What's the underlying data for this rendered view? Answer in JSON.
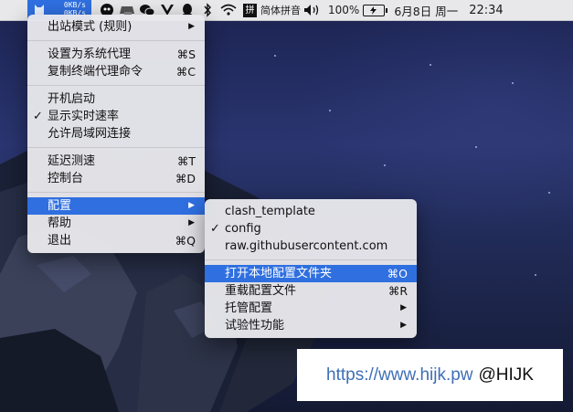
{
  "menubar": {
    "speed_up": "0KB/s",
    "speed_down": "0KB/s",
    "ime_glyph": "拼",
    "ime_label": "简体拼音",
    "battery_percent": "100%",
    "date": "6月8日 周一",
    "time": "22:34",
    "tray_icons": [
      "network-speed-icon",
      "notes-icon",
      "wechat-icon",
      "vue-icon",
      "qq-icon",
      "bluetooth-icon",
      "wifi-icon",
      "ime-icon",
      "volume-icon",
      "battery-icon"
    ]
  },
  "main_menu": {
    "items": [
      {
        "label": "出站模式 (规则)",
        "shortcut": "",
        "submenu": true
      },
      {
        "label": "设置为系统代理",
        "shortcut": "⌘S"
      },
      {
        "label": "复制终端代理命令",
        "shortcut": "⌘C"
      },
      {
        "label": "开机启动",
        "shortcut": ""
      },
      {
        "label": "显示实时速率",
        "shortcut": "",
        "checked": true
      },
      {
        "label": "允许局域网连接",
        "shortcut": ""
      },
      {
        "label": "延迟测速",
        "shortcut": "⌘T"
      },
      {
        "label": "控制台",
        "shortcut": "⌘D"
      },
      {
        "label": "配置",
        "shortcut": "",
        "submenu": true,
        "highlighted": true
      },
      {
        "label": "帮助",
        "shortcut": "",
        "submenu": true
      },
      {
        "label": "退出",
        "shortcut": "⌘Q"
      }
    ]
  },
  "config_submenu": {
    "items": [
      {
        "label": "clash_template"
      },
      {
        "label": "config",
        "checked": true
      },
      {
        "label": "raw.githubusercontent.com"
      },
      {
        "label": "打开本地配置文件夹",
        "shortcut": "⌘O",
        "highlighted": true
      },
      {
        "label": "重载配置文件",
        "shortcut": "⌘R"
      },
      {
        "label": "托管配置",
        "submenu": true
      },
      {
        "label": "试验性功能",
        "submenu": true
      }
    ]
  },
  "watermark": {
    "url": "https://www.hijk.pw",
    "handle": "@HIJK"
  },
  "symbols": {
    "check": "✓",
    "arrow": "▶"
  },
  "colors": {
    "accent": "#2f6fe0",
    "menubar_bg": "#e8e8ea",
    "menu_bg": "#e8e8ec",
    "watermark_url": "#3f6fb5"
  }
}
